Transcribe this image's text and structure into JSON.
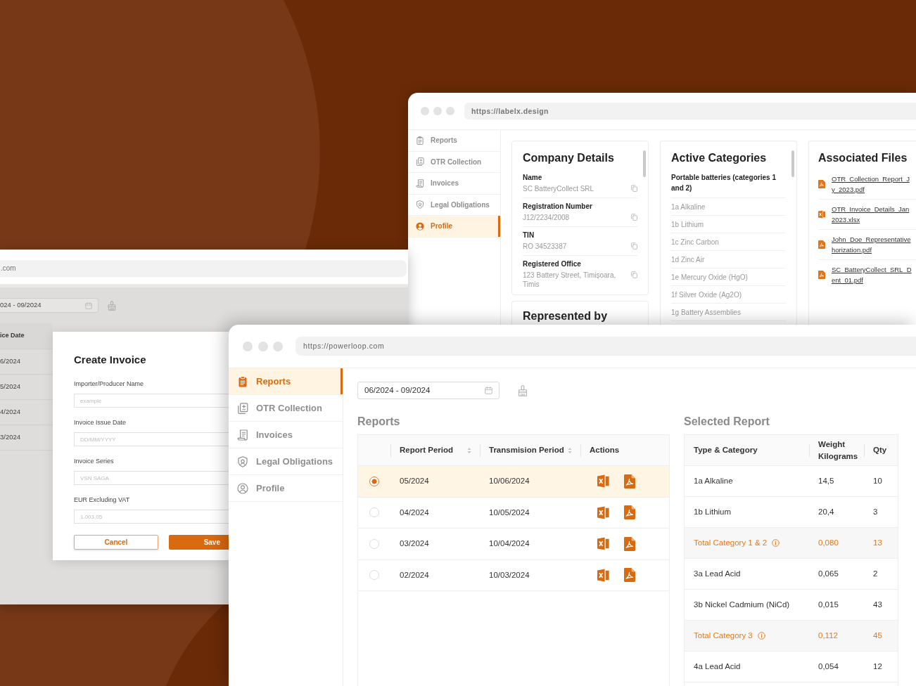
{
  "back_window": {
    "url": "https://labelx.design",
    "sidebar": [
      {
        "label": "Reports",
        "selected": false
      },
      {
        "label": "OTR Collection",
        "selected": false
      },
      {
        "label": "Invoices",
        "selected": false
      },
      {
        "label": "Legal Obligations",
        "selected": false
      },
      {
        "label": "Profile",
        "selected": true
      }
    ],
    "company_details": {
      "title": "Company Details",
      "fields": [
        {
          "label": "Name",
          "value": "SC BatteryCollect SRL"
        },
        {
          "label": "Registration Number",
          "value": "J12/2234/2008"
        },
        {
          "label": "TIN",
          "value": "RO 34523387"
        },
        {
          "label": "Registered Office",
          "value": "123 Battery Street, Timișoara, Timis"
        }
      ]
    },
    "represented_by": {
      "title": "Represented by"
    },
    "active_categories": {
      "title": "Active Categories",
      "group": "Portable batteries (categories 1 and 2)",
      "items": [
        "1a Alkaline",
        "1b Lithium",
        "1c Zinc Carbon",
        "1d Zinc Air",
        "1e Mercury Oxide (HgO)",
        "1f Silver Oxide (Ag2O)",
        "1g Battery Assemblies"
      ]
    },
    "associated_files": {
      "title": "Associated Files",
      "files": [
        {
          "kind": "pdf",
          "lines": [
            "OTR_Collection_Report_J",
            "y_2023.pdf"
          ]
        },
        {
          "kind": "spreadsheet",
          "lines": [
            "OTR_Invoice_Details_Jan",
            "2023.xlsx"
          ]
        },
        {
          "kind": "pdf",
          "lines": [
            "John_Doe_Representative",
            "horization.pdf"
          ]
        },
        {
          "kind": "pdf",
          "lines": [
            "SC_BatteryCollect_SRL_D",
            "ent_01.pdf"
          ]
        }
      ]
    }
  },
  "left_window": {
    "url": ".com",
    "date_range": "024 - 09/2024",
    "table": {
      "columns": [
        "ice Date"
      ],
      "rows": [
        "6/2024",
        "5/2024",
        "4/2024",
        "3/2024"
      ]
    },
    "dialog": {
      "title": "Create Invoice",
      "fields": [
        {
          "label": "Importer/Producer Name",
          "placeholder": "example"
        },
        {
          "label": "Invoice Issue Date",
          "placeholder": "DD/MM/YYYY"
        },
        {
          "label": "Invoice Series",
          "placeholder": "VSN SAGA"
        },
        {
          "label": "EUR Excluding VAT",
          "placeholder": "1.003,05"
        }
      ],
      "buttons": {
        "cancel": "Cancel",
        "save": "Save"
      }
    }
  },
  "front_window": {
    "url": "https://powerloop.com",
    "sidebar": [
      {
        "label": "Reports",
        "selected": true
      },
      {
        "label": "OTR Collection",
        "selected": false
      },
      {
        "label": "Invoices",
        "selected": false
      },
      {
        "label": "Legal Obligations",
        "selected": false
      },
      {
        "label": "Profile",
        "selected": false
      }
    ],
    "date_range": "06/2024 - 09/2024",
    "reports": {
      "title": "Reports",
      "columns": [
        {
          "label": "Report Period",
          "sortable": true
        },
        {
          "label": "Transmision Period",
          "sortable": true
        },
        {
          "label": "Actions",
          "sortable": false
        }
      ],
      "rows": [
        {
          "selected": true,
          "report_period": "05/2024",
          "transmission_period": "10/06/2024"
        },
        {
          "selected": false,
          "report_period": "04/2024",
          "transmission_period": "10/05/2024"
        },
        {
          "selected": false,
          "report_period": "03/2024",
          "transmission_period": "10/04/2024"
        },
        {
          "selected": false,
          "report_period": "02/2024",
          "transmission_period": "10/03/2024"
        }
      ]
    },
    "selected_report": {
      "title": "Selected Report",
      "columns": [
        "Type & Category",
        "Weight Kilograms",
        "Qty"
      ],
      "rows": [
        {
          "kind": "item",
          "type_category": "1a Alkaline",
          "weight": "14,5",
          "qty": "10"
        },
        {
          "kind": "item",
          "type_category": "1b Lithium",
          "weight": "20,4",
          "qty": "3"
        },
        {
          "kind": "total",
          "type_category": "Total Category 1 & 2",
          "weight": "0,080",
          "qty": "13"
        },
        {
          "kind": "item",
          "type_category": "3a Lead Acid",
          "weight": "0,065",
          "qty": "2"
        },
        {
          "kind": "item",
          "type_category": "3b Nickel Cadmium (NiCd)",
          "weight": "0,015",
          "qty": "43"
        },
        {
          "kind": "total",
          "type_category": "Total Category 3",
          "weight": "0,112",
          "qty": "45"
        },
        {
          "kind": "item",
          "type_category": "4a Lead Acid",
          "weight": "0,054",
          "qty": "12"
        }
      ]
    }
  }
}
